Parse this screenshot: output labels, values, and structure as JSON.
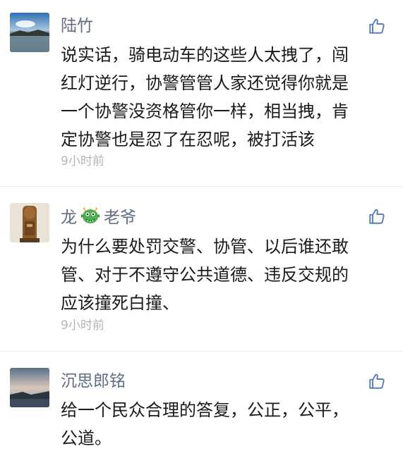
{
  "comments": [
    {
      "username": "陆竹",
      "lines": [
        "说实话，骑电动车的这些人太拽了，闯",
        "红灯逆行，协警管管人家还觉得你就是",
        "一个协警没资格管你一样，相当拽，肯",
        "定协警也是忍了在忍呢，被打活该"
      ],
      "time": "9小时前",
      "avatar": "lake-landscape"
    },
    {
      "username_prefix": "龙",
      "username_emoji": "dragon-emoji",
      "username_suffix": "老爷",
      "lines": [
        "为什么要处罚交警、协管、以后谁还敢",
        "管、对于不遵守公共道德、违反交规的",
        "应该撞死白撞、"
      ],
      "time": "9小时前",
      "avatar": "wooden-statue"
    },
    {
      "username": "沉思郎铭",
      "lines": [
        "给一个民众合理的答复，公正，公平，",
        "公道。"
      ],
      "avatar": "sunset-coast"
    }
  ],
  "icons": {
    "like": "thumbs-up-icon"
  },
  "colors": {
    "username": "#5f6e80",
    "like_icon": "#5b7fb8",
    "timestamp": "#b4b4b4"
  }
}
